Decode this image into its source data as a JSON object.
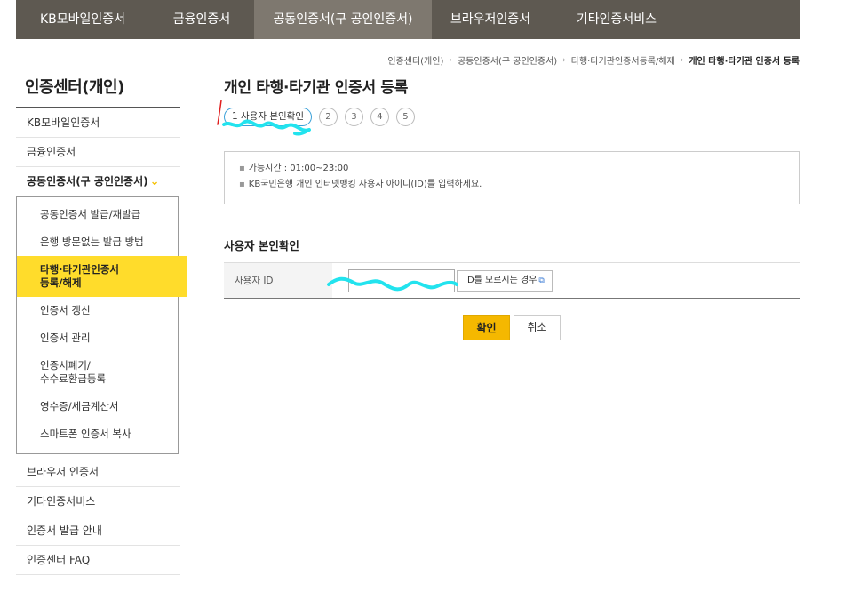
{
  "topnav": {
    "items": [
      {
        "label": "KB모바일인증서"
      },
      {
        "label": "금융인증서"
      },
      {
        "label": "공동인증서(구 공인인증서)"
      },
      {
        "label": "브라우저인증서"
      },
      {
        "label": "기타인증서비스"
      }
    ]
  },
  "breadcrumb": {
    "items": [
      "인증센터(개인)",
      "공동인증서(구 공인인증서)",
      "타행·타기관인증서등록/해제"
    ],
    "current": "개인 타행·타기관 인증서 등록"
  },
  "sidebar": {
    "title": "인증센터(개인)",
    "items_before": [
      "KB모바일인증서",
      "금융인증서"
    ],
    "open_item": "공동인증서(구 공인인증서)",
    "open_icon": "chevron-down-icon",
    "submenu": [
      "공동인증서 발급/재발급",
      "은행 방문없는 발급 방법",
      "타행·타기관인증서\n등록/해제",
      "인증서 갱신",
      "인증서 관리",
      "인증서폐기/\n수수료환급등록",
      "영수증/세금계산서",
      "스마트폰 인증서 복사"
    ],
    "items_after": [
      "브라우저 인증서",
      "기타인증서비스",
      "인증서 발급 안내",
      "인증센터 FAQ"
    ]
  },
  "main": {
    "title": "개인 타행·타기관 인증서 등록",
    "steps": {
      "current": "1 사용자 본인확인",
      "others": [
        "2",
        "3",
        "4",
        "5"
      ]
    },
    "info": {
      "lines": [
        "가능시간 : 01:00~23:00",
        "KB국민은행 개인 인터넷뱅킹 사용자 아이디(ID)를 입력하세요."
      ]
    },
    "section_title": "사용자 본인확인",
    "form": {
      "user_id_label": "사용자 ID",
      "user_id_value": "",
      "help_link": "ID를 모르시는 경우",
      "help_icon": "external-link-icon"
    },
    "buttons": {
      "confirm": "확인",
      "cancel": "취소"
    }
  },
  "colors": {
    "topnav_bg": "#5e5951",
    "topnav_active": "#7e786f",
    "accent_yellow": "#ffdc2b",
    "confirm_button": "#f5b800",
    "step_border": "#3aa0d8",
    "annotation_cyan": "#22e3ee",
    "annotation_red": "#e02020"
  }
}
